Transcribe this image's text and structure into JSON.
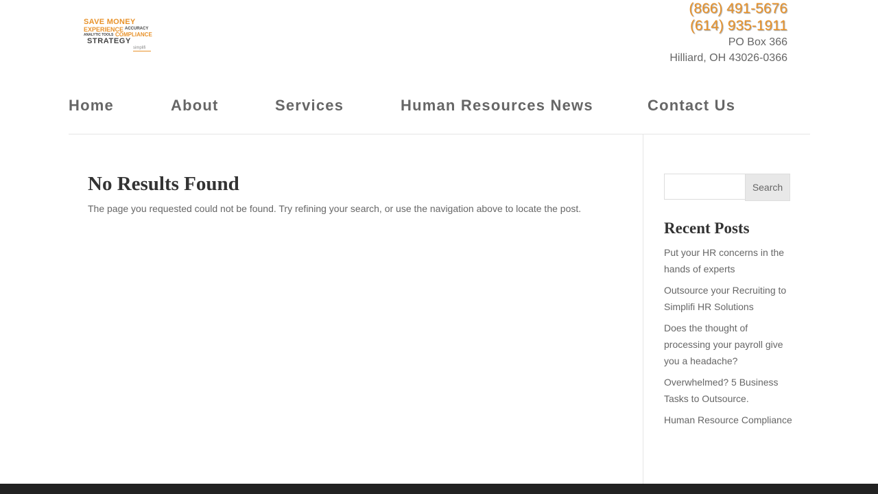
{
  "logo": {
    "line1": "SAVE MONEY",
    "line2": "EXPERIENCE",
    "line2b": "ACCURACY",
    "line3a": "ANALYTIC TOOLS",
    "line3b": "COMPLIANCE",
    "line4": "STRATEGY",
    "line5": "simplifi"
  },
  "header": {
    "phone1": "(866) 491-5676",
    "phone2": "(614) 935-1911",
    "address1": "PO Box 366",
    "address2": "Hilliard, OH 43026-0366"
  },
  "nav": {
    "items": [
      {
        "label": "Home"
      },
      {
        "label": "About"
      },
      {
        "label": "Services"
      },
      {
        "label": "Human Resources News"
      },
      {
        "label": "Contact Us"
      }
    ]
  },
  "main": {
    "title": "No Results Found",
    "message": "The page you requested could not be found. Try refining your search, or use the navigation above to locate the post."
  },
  "sidebar": {
    "search": {
      "placeholder": "",
      "button_label": "Search"
    },
    "recent_title": "Recent Posts",
    "posts": [
      {
        "label": "Put your HR concerns in the hands of experts"
      },
      {
        "label": "Outsource your Recruiting to Simplifi HR Solutions"
      },
      {
        "label": "Does the thought of processing your payroll give you a headache?"
      },
      {
        "label": "Overwhelmed? 5 Business Tasks to Outsource."
      },
      {
        "label": "Human Resource Compliance"
      }
    ]
  },
  "colors": {
    "accent": "#e8922a",
    "text": "#666666",
    "heading": "#333333",
    "footer": "#222222"
  }
}
